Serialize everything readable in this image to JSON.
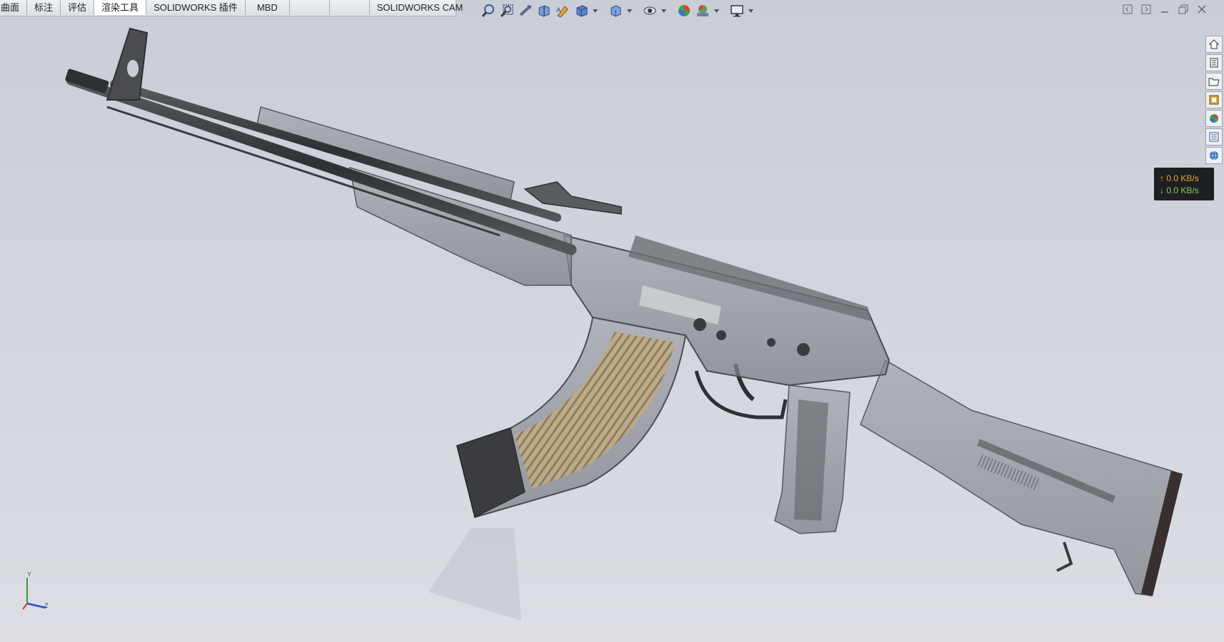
{
  "command_tabs": [
    {
      "label": "曲面",
      "active": false
    },
    {
      "label": "标注",
      "active": false
    },
    {
      "label": "评估",
      "active": false
    },
    {
      "label": "渲染工具",
      "active": true
    },
    {
      "label": "SOLIDWORKS 插件",
      "active": false
    },
    {
      "label": "MBD",
      "active": false
    },
    {
      "label": "",
      "active": false
    },
    {
      "label": "",
      "active": false
    },
    {
      "label": "SOLIDWORKS CAM",
      "active": false
    }
  ],
  "view_toolbar": [
    "zoom-to-fit-icon",
    "zoom-to-area-icon",
    "previous-view-icon",
    "section-view-icon",
    "dynamic-annotation-view-icon",
    "view-orientation-icon",
    "display-style-icon",
    "hide-show-items-icon",
    "edit-appearance-icon",
    "apply-scene-icon",
    "view-settings-icon"
  ],
  "task_pane": [
    "home-icon",
    "design-library-icon",
    "file-explorer-icon",
    "view-palette-icon",
    "appearances-scenes-icon",
    "custom-properties-icon",
    "resources-icon"
  ],
  "network_speed": {
    "upload": "↑ 0.0 KB/s",
    "download": "↓ 0.0 KB/s"
  },
  "triad": {
    "y_label": "Y",
    "z_label": "Z"
  },
  "colors": {
    "background_top": "#c9cdd6",
    "background_bottom": "#dcdee4",
    "model_dark": "#3c3d40",
    "model_translucent": "#8a8d92",
    "magazine_rounds": "#b7a27a",
    "netspeed_bg": "#1e1f22",
    "upload_text": "#f0a030",
    "download_text": "#7dd94a"
  }
}
